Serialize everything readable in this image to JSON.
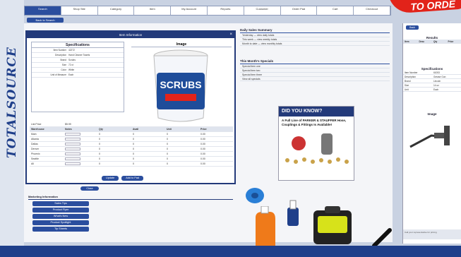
{
  "brand": {
    "logo_text": "TOTALSOURCE"
  },
  "ribbon": {
    "text": "TO ORDE"
  },
  "nav": {
    "tabs": [
      "Search",
      "Shop Site",
      "Category",
      "Item",
      "My Account",
      "Reports",
      "Customer",
      "Order Pad",
      "Cart",
      "Checkout"
    ],
    "back_label": "Back to Search"
  },
  "modal": {
    "title": "Item Information",
    "close_label": "×",
    "spec_heading": "Specifications",
    "spec_rows": [
      {
        "k": "Item Number",
        "v": "42272"
      },
      {
        "k": "Description",
        "v": "Hand Cleaner Towels"
      },
      {
        "k": "Brand",
        "v": "Scrubs"
      },
      {
        "k": "Size",
        "v": "72 ct"
      },
      {
        "k": "Color",
        "v": "White"
      },
      {
        "k": "Unit of Measure",
        "v": "Each"
      }
    ],
    "image_heading": "Image",
    "tub_label": "SCRUBS",
    "list_price_label": "List Price",
    "list_price_value": "$5.99",
    "pricing_headers": [
      "Warehouse",
      "Notes",
      "Qty",
      "Avail",
      "Unit",
      "Price"
    ],
    "pricing_rows": [
      [
        "Main",
        "",
        "0",
        "0",
        "0",
        "0.00"
      ],
      [
        "Atlanta",
        "",
        "0",
        "0",
        "0",
        "0.00"
      ],
      [
        "Dallas",
        "",
        "0",
        "0",
        "0",
        "0.00"
      ],
      [
        "Denver",
        "",
        "0",
        "0",
        "0",
        "0.00"
      ],
      [
        "Phoenix",
        "",
        "0",
        "0",
        "0",
        "0.00"
      ],
      [
        "Seattle",
        "",
        "0",
        "0",
        "0",
        "0.00"
      ],
      [
        "All",
        "",
        "0",
        "0",
        "0",
        "0.00"
      ]
    ],
    "buttons": [
      "Update",
      "Add to Pad"
    ]
  },
  "close_button": "Close",
  "marketing": {
    "heading": "Marketing Information",
    "buttons": [
      "Sales Tips",
      "Product Flyer",
      "What's New",
      "Product Spotlight",
      "Tip Sheets"
    ]
  },
  "sales_summary": {
    "heading": "Daily Sales Summary",
    "items": [
      "Yesterday — view daily totals",
      "This week — view weekly totals",
      "Month to date — view monthly totals"
    ]
  },
  "monthly_specials": {
    "heading": "This Month's Specials",
    "items": [
      "Special item one",
      "Special item two",
      "Special item three",
      "View all specials"
    ]
  },
  "dyk": {
    "title": "DID YOU KNOW?",
    "body": "A Full Line of PARKER & STAUFFER Hose, Couplings & Fittings Is Available!"
  },
  "right": {
    "back_label": "Back",
    "results_heading": "Results",
    "results_headers": [
      "Item",
      "Desc",
      "Qty",
      "Price"
    ],
    "spec_heading": "Specifications",
    "spec_rows": [
      [
        "Item Number",
        "61053"
      ],
      [
        "Description",
        "Grease Gun"
      ],
      [
        "Brand",
        "Lincoln"
      ],
      [
        "Size",
        "14 oz"
      ],
      [
        "Unit",
        "Each"
      ]
    ],
    "image_heading": "Image",
    "note": "Call your representative for pricing"
  },
  "colors": {
    "brand_blue": "#2b4e9e",
    "dark_blue": "#1f3f8a",
    "red": "#e2231a"
  }
}
